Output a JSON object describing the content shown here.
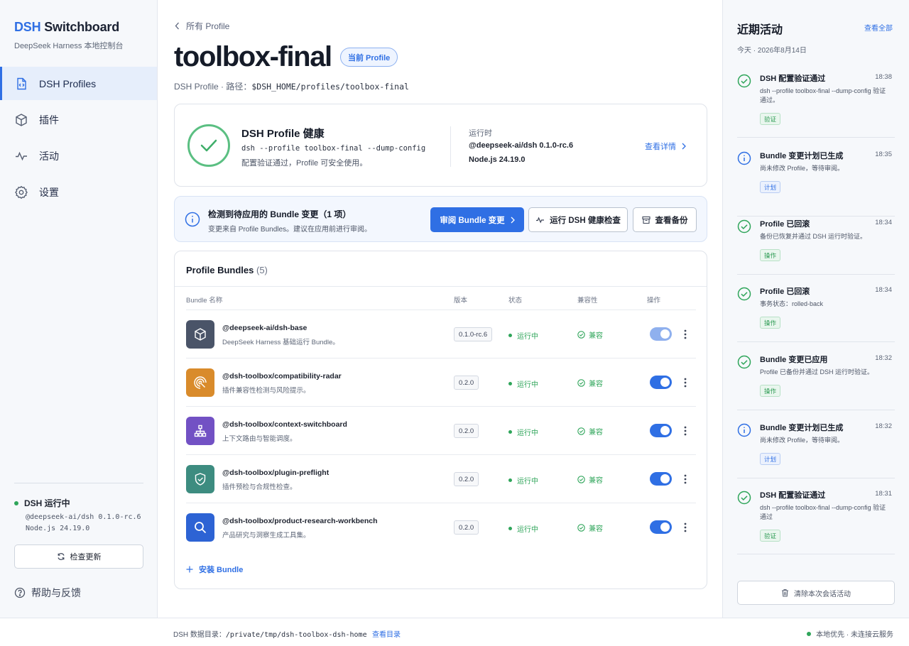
{
  "brand": {
    "prefix": "DSH",
    "name": " Switchboard",
    "subtitle": "DeepSeek Harness 本地控制台"
  },
  "sidebar": {
    "items": [
      {
        "label": "DSH Profiles",
        "icon": "file-code-icon",
        "active": true
      },
      {
        "label": "插件",
        "icon": "cube-icon",
        "active": false
      },
      {
        "label": "活动",
        "icon": "activity-icon",
        "active": false
      },
      {
        "label": "设置",
        "icon": "gear-icon",
        "active": false
      }
    ],
    "runtime": {
      "title": "DSH 运行中",
      "version": "@deepseek-ai/dsh 0.1.0-rc.6",
      "node": "Node.js 24.19.0"
    },
    "update_label": "检查更新",
    "help_label": "帮助与反馈"
  },
  "main": {
    "back_label": "所有 Profile",
    "title": "toolbox-final",
    "current_badge": "当前 Profile",
    "subtitle_prefix": "DSH Profile · 路径：",
    "path": "$DSH_HOME/profiles/toolbox-final",
    "health": {
      "title": "DSH Profile 健康",
      "command": "dsh --profile toolbox-final --dump-config",
      "desc": "配置验证通过，Profile 可安全使用。",
      "runtime_label": "运行时",
      "runtime_v1": "@deepseek-ai/dsh 0.1.0-rc.6",
      "runtime_v2": "Node.js 24.19.0",
      "details_link": "查看详情"
    },
    "notice": {
      "title": "检测到待应用的 Bundle 变更（1 项）",
      "desc": "变更来自 Profile Bundles。建议在应用前进行审阅。",
      "review_btn": "审阅 Bundle 变更",
      "health_btn": "运行 DSH 健康检查",
      "backup_btn": "查看备份"
    },
    "bundles": {
      "title": "Profile Bundles",
      "count": "(5)",
      "headers": {
        "name": "Bundle 名称",
        "version": "版本",
        "status": "状态",
        "compat": "兼容性",
        "actions": "操作"
      },
      "rows": [
        {
          "name": "@deepseek-ai/dsh-base",
          "desc": "DeepSeek Harness 基础运行 Bundle。",
          "version": "0.1.0-rc.6",
          "status": "运行中",
          "compat": "兼容",
          "icon": "cube-icon",
          "color": "#4a5468",
          "enabled": true,
          "locked": true
        },
        {
          "name": "@dsh-toolbox/compatibility-radar",
          "desc": "插件兼容性检测与风险提示。",
          "version": "0.2.0",
          "status": "运行中",
          "compat": "兼容",
          "icon": "radar-icon",
          "color": "#d98b2b",
          "enabled": true,
          "locked": false
        },
        {
          "name": "@dsh-toolbox/context-switchboard",
          "desc": "上下文路由与智能调度。",
          "version": "0.2.0",
          "status": "运行中",
          "compat": "兼容",
          "icon": "network-icon",
          "color": "#7251c4",
          "enabled": true,
          "locked": false
        },
        {
          "name": "@dsh-toolbox/plugin-preflight",
          "desc": "插件预检与合规性检查。",
          "version": "0.2.0",
          "status": "运行中",
          "compat": "兼容",
          "icon": "shield-check-icon",
          "color": "#3d8c80",
          "enabled": true,
          "locked": false
        },
        {
          "name": "@dsh-toolbox/product-research-workbench",
          "desc": "产品研究与洞察生成工具集。",
          "version": "0.2.0",
          "status": "运行中",
          "compat": "兼容",
          "icon": "search-icon",
          "color": "#2d63d4",
          "enabled": true,
          "locked": false
        }
      ],
      "install_label": "安装 Bundle"
    }
  },
  "activity": {
    "title": "近期活动",
    "view_all": "查看全部",
    "date": "今天 · 2026年8月14日",
    "items": [
      {
        "type": "check",
        "title": "DSH 配置验证通过",
        "time": "18:38",
        "desc": "dsh --profile toolbox-final --dump-config 验证通过。",
        "tag": "验证",
        "tagColor": "green"
      },
      {
        "type": "info",
        "title": "Bundle 变更计划已生成",
        "time": "18:35",
        "desc": "尚未修改 Profile，等待审阅。",
        "tag": "计划",
        "tagColor": "blue"
      },
      {
        "type": "check",
        "title": "Profile 已回滚",
        "time": "18:34",
        "desc": "备份已恢复并通过 DSH 运行时验证。",
        "tag": "操作",
        "tagColor": "green"
      },
      {
        "type": "check",
        "title": "Profile 已回滚",
        "time": "18:34",
        "desc": "事务状态：rolled-back",
        "tag": "操作",
        "tagColor": "green"
      },
      {
        "type": "check",
        "title": "Bundle 变更已应用",
        "time": "18:32",
        "desc": "Profile 已备份并通过 DSH 运行时验证。",
        "tag": "操作",
        "tagColor": "green"
      },
      {
        "type": "info",
        "title": "Bundle 变更计划已生成",
        "time": "18:32",
        "desc": "尚未修改 Profile，等待审阅。",
        "tag": "计划",
        "tagColor": "blue"
      },
      {
        "type": "check",
        "title": "DSH 配置验证通过",
        "time": "18:31",
        "desc": "dsh --profile toolbox-final --dump-config 验证通过",
        "tag": "验证",
        "tagColor": "green"
      }
    ],
    "clear_label": "清除本次会话活动"
  },
  "footer": {
    "label": "DSH 数据目录：",
    "path": "/private/tmp/dsh-toolbox-dsh-home",
    "link": "查看目录",
    "status": "本地优先 · 未连接云服务"
  },
  "colors": {
    "accent": "#2f6fe4",
    "success": "#2fa55a"
  }
}
